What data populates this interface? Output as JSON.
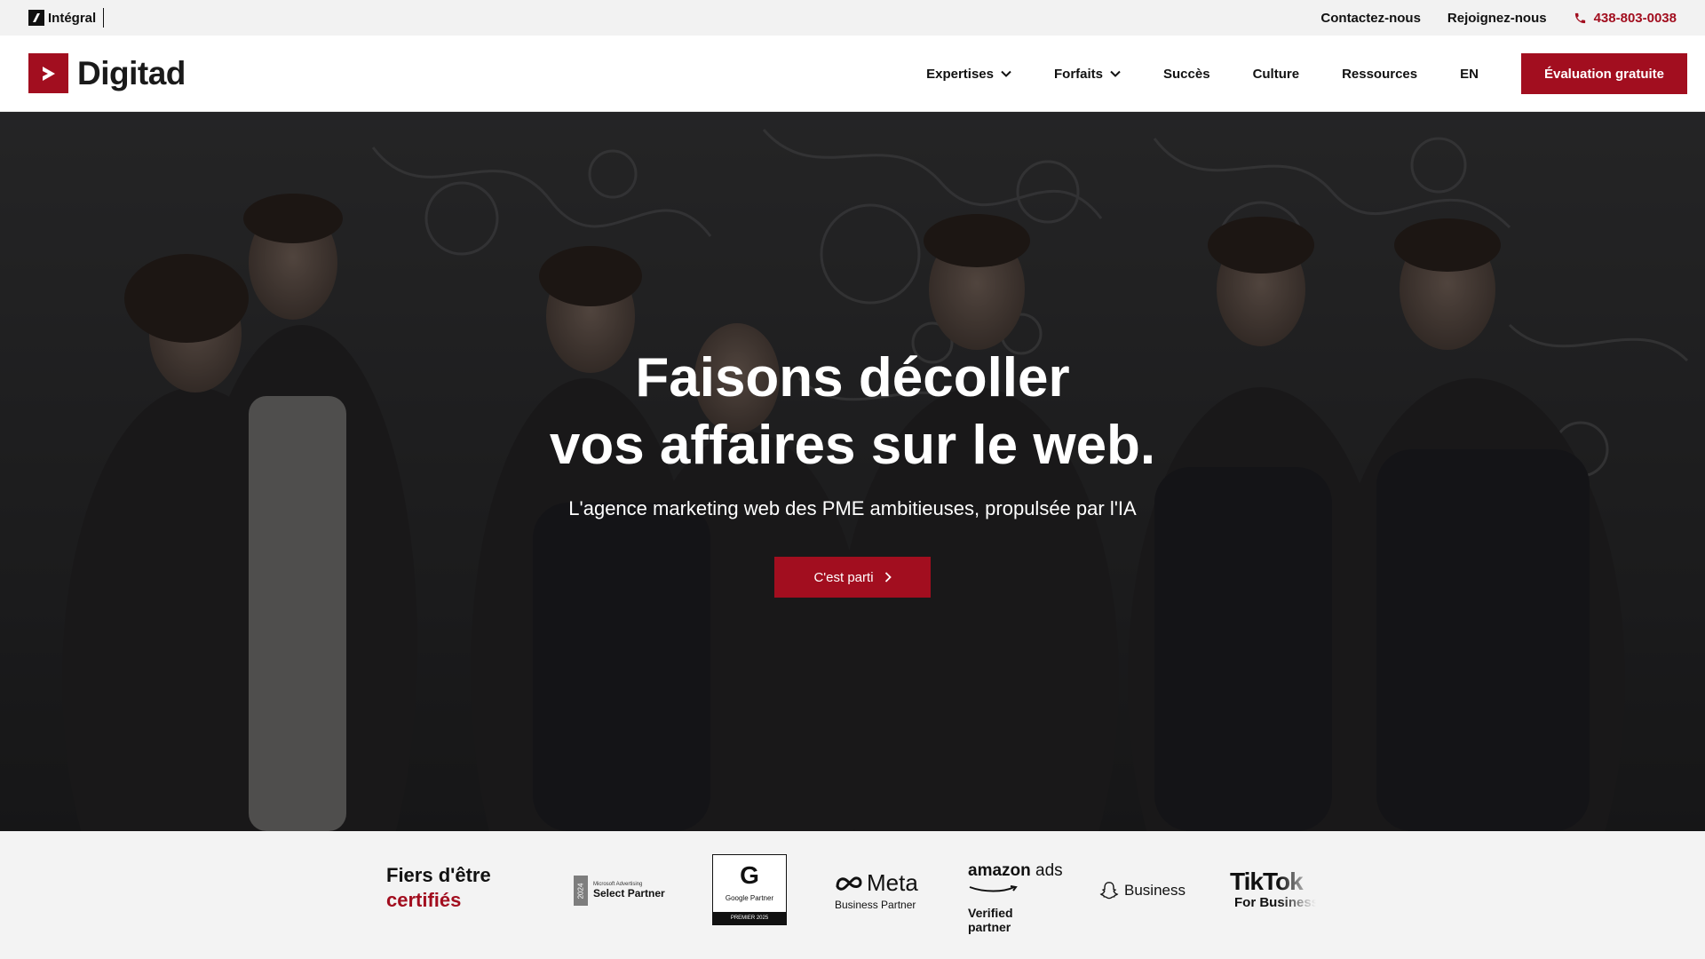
{
  "topbar": {
    "brand": "Intégral",
    "links": [
      "Contactez-nous",
      "Rejoignez-nous"
    ],
    "phone": "438-803-0038"
  },
  "header": {
    "logo_text": "Digitad",
    "nav": [
      {
        "label": "Expertises",
        "dropdown": true
      },
      {
        "label": "Forfaits",
        "dropdown": true
      },
      {
        "label": "Succès",
        "dropdown": false
      },
      {
        "label": "Culture",
        "dropdown": false
      },
      {
        "label": "Ressources",
        "dropdown": false
      },
      {
        "label": "EN",
        "dropdown": false
      }
    ],
    "cta": "Évaluation gratuite"
  },
  "hero": {
    "title_line1": "Faisons décoller",
    "title_line2": "vos affaires sur le web.",
    "subtitle": "L'agence marketing web des PME ambitieuses, propulsée par l'IA",
    "button": "C'est parti"
  },
  "partners": {
    "heading_line1": "Fiers d'être",
    "heading_line2": "certifiés",
    "microsoft": {
      "year": "2024",
      "small": "Microsoft Advertising",
      "label": "Select Partner"
    },
    "google": {
      "letter": "G",
      "label": "Google Partner",
      "foot": "PREMIER 2025"
    },
    "meta": {
      "name": "Meta",
      "sub": "Business Partner"
    },
    "amazon": {
      "name": "amazon",
      "ads": "ads",
      "line1": "Verified",
      "line2": "partner"
    },
    "snapchat": {
      "label": "Business"
    },
    "tiktok": {
      "name": "TikTok",
      "sub": "For Business"
    }
  },
  "colors": {
    "brand": "#a20e1f",
    "topbar_bg": "#f2f2f2",
    "partners_bg": "#f3f3f3"
  }
}
